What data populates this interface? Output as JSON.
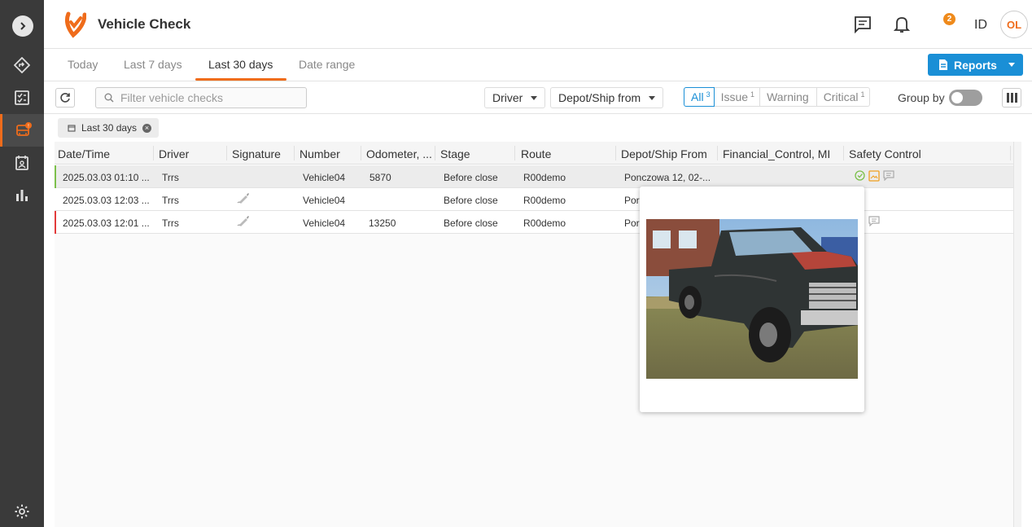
{
  "app": {
    "title": "Vehicle Check",
    "brand_color": "#ef6c1b",
    "accent_color": "#1a8fd6"
  },
  "header": {
    "notification_count": "2",
    "language": "ID",
    "user_initials": "OL"
  },
  "period_tabs": [
    {
      "label": "Today",
      "active": false
    },
    {
      "label": "Last 7 days",
      "active": false
    },
    {
      "label": "Last 30 days",
      "active": true
    },
    {
      "label": "Date range",
      "active": false
    }
  ],
  "reports_button": {
    "label": "Reports"
  },
  "toolbar": {
    "search_placeholder": "Filter vehicle checks",
    "driver_filter": "Driver",
    "depot_filter": "Depot/Ship from",
    "severity": [
      {
        "label": "All",
        "count": "3",
        "selected": true
      },
      {
        "label": "Issue",
        "count": "1",
        "selected": false
      },
      {
        "label": "Warning",
        "count": "",
        "selected": false
      },
      {
        "label": "Critical",
        "count": "1",
        "selected": false
      }
    ],
    "group_by_label": "Group by",
    "group_by_enabled": false
  },
  "active_filter_chip": "Last 30 days",
  "table": {
    "columns": [
      "Date/Time",
      "Driver",
      "Signature",
      "Number",
      "Odometer, ...",
      "Stage",
      "Route",
      "Depot/Ship From",
      "Financial_Control, MI",
      "Safety Control"
    ],
    "rows": [
      {
        "datetime": "2025.03.03 01:10 ...",
        "driver": "Trrs",
        "signature": false,
        "number": "Vehicle04",
        "odometer": "5870",
        "stage": "Before close",
        "route": "R00demo",
        "depot": "Ponczowa 12, 02-...",
        "financial": "",
        "status_color": "#7cc04b",
        "selected": true
      },
      {
        "datetime": "2025.03.03 12:03 ...",
        "driver": "Trrs",
        "signature": true,
        "number": "Vehicle04",
        "odometer": "",
        "stage": "Before close",
        "route": "R00demo",
        "depot": "Por",
        "financial": "",
        "status_color": "",
        "selected": false
      },
      {
        "datetime": "2025.03.03 12:01 ...",
        "driver": "Trrs",
        "signature": true,
        "number": "Vehicle04",
        "odometer": "13250",
        "stage": "Before close",
        "route": "R00demo",
        "depot": "Por",
        "financial": "",
        "status_color": "#e23b3b",
        "selected": false
      }
    ]
  },
  "icons": {
    "sidebar": [
      "chevron-right-icon",
      "route-icon",
      "checklist-icon",
      "vehicle-check-icon",
      "calendar-person-icon",
      "bar-chart-icon",
      "settings-icon"
    ],
    "header": [
      "chat-icon",
      "bell-icon"
    ]
  }
}
